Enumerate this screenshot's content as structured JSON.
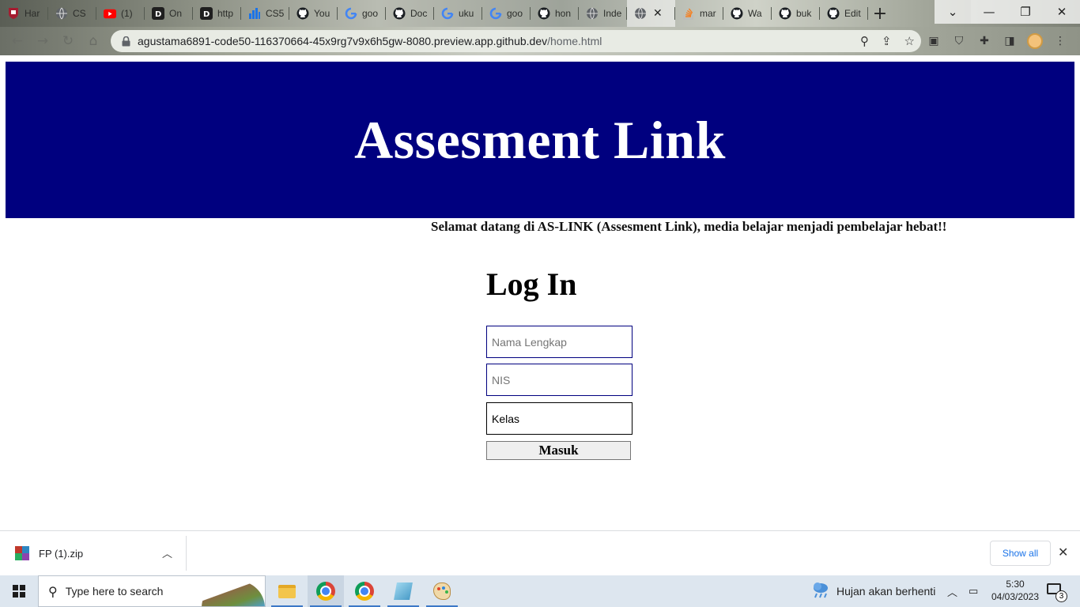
{
  "browser": {
    "tabs": [
      {
        "label": "Har",
        "icon": "harvard-shield-icon"
      },
      {
        "label": "CS",
        "icon": "globe-icon"
      },
      {
        "label": "(1)",
        "icon": "youtube-icon"
      },
      {
        "label": "On",
        "icon": "d-logo-icon"
      },
      {
        "label": "http",
        "icon": "d-logo-icon"
      },
      {
        "label": "CS5",
        "icon": "bar-chart-icon"
      },
      {
        "label": "You",
        "icon": "github-icon"
      },
      {
        "label": "goo",
        "icon": "google-icon"
      },
      {
        "label": "Doc",
        "icon": "github-icon"
      },
      {
        "label": "uku",
        "icon": "google-icon"
      },
      {
        "label": "goo",
        "icon": "google-icon"
      },
      {
        "label": "hon",
        "icon": "github-icon"
      },
      {
        "label": "Inde",
        "icon": "globe-icon"
      },
      {
        "label": "",
        "icon": "globe-icon",
        "active": true
      },
      {
        "label": "mar",
        "icon": "stackoverflow-icon"
      },
      {
        "label": "Wa",
        "icon": "github-icon"
      },
      {
        "label": "buk",
        "icon": "github-icon"
      },
      {
        "label": "Edit",
        "icon": "github-icon"
      }
    ],
    "new_tab": "+",
    "url_host": "agustama6891-code50-116370664-45x9rg7v9x6h5gw-8080.preview.app.github.dev",
    "url_path": "/home.html"
  },
  "page": {
    "banner_title": "Assesment Link",
    "welcome": "Selamat datang di AS-LINK (Assesment Link), media belajar menjadi pembelajar hebat!!",
    "login_title": "Log In",
    "name_placeholder": "Nama Lengkap",
    "nis_placeholder": "NIS",
    "kelas_value": "Kelas",
    "submit_label": "Masuk"
  },
  "downloads": {
    "file_name": "FP (1).zip",
    "show_all": "Show all"
  },
  "taskbar": {
    "search_placeholder": "Type here to search",
    "weather": "Hujan akan berhenti",
    "time": "5:30",
    "date": "04/03/2023",
    "notification_count": "3"
  },
  "colors": {
    "banner": "#00007f",
    "field_border": "#00007f"
  }
}
